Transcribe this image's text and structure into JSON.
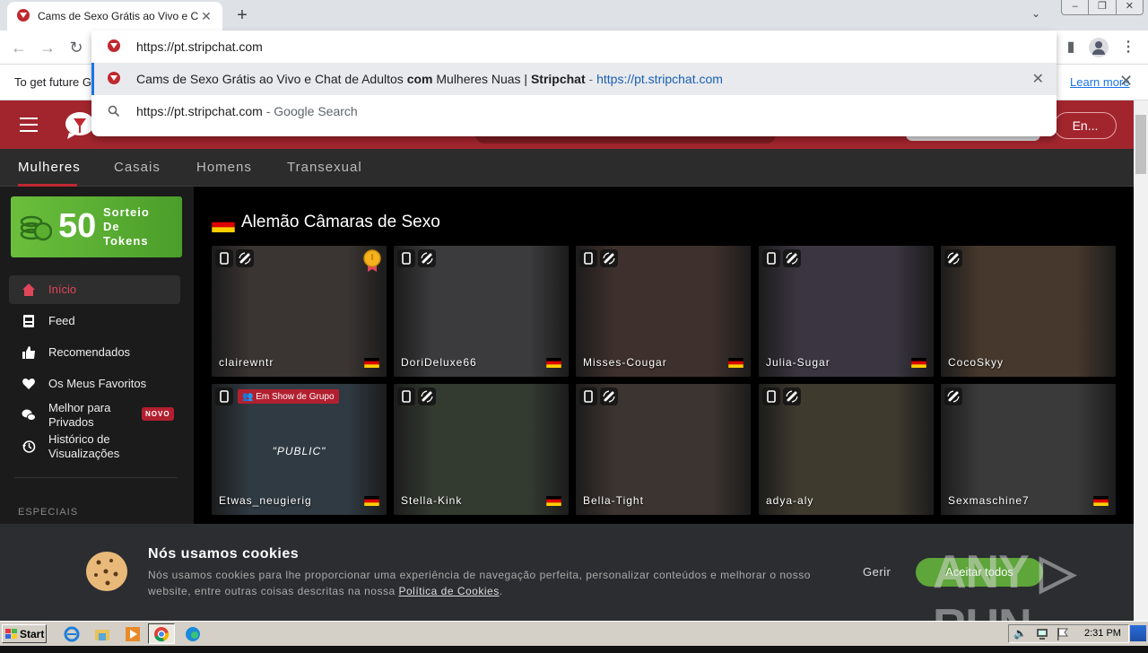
{
  "browser": {
    "tab_title": "Cams de Sexo Grátis ao Vivo e Chat de Adultos",
    "tab_close": "✕",
    "new_tab": "+",
    "tab_search": "⌄",
    "window_buttons": [
      "–",
      "❐",
      "✕"
    ],
    "omnibox_value": "https://pt.stripchat.com",
    "suggestions": [
      {
        "type": "history",
        "parts": [
          {
            "text": "Cams de Sexo Grátis ao Vivo e Chat de Adultos ",
            "style": "normal"
          },
          {
            "text": "com",
            "style": "bold"
          },
          {
            "text": " Mulheres Nuas | ",
            "style": "normal"
          },
          {
            "text": "Stripchat",
            "style": "bold"
          },
          {
            "text": " - ",
            "style": "grey"
          },
          {
            "text": "https://pt.stripchat.com",
            "style": "url"
          }
        ],
        "remove": "✕"
      },
      {
        "type": "search",
        "parts": [
          {
            "text": "https://pt.stripchat.com",
            "style": "normal"
          },
          {
            "text": " - Google Search",
            "style": "grey"
          }
        ]
      }
    ],
    "infobar_text": "To get future Google Chrome updates...",
    "infobar_link": "Learn more",
    "infobar_close": "✕"
  },
  "site": {
    "brand_color": "#a2252d",
    "lang_button": "En...",
    "category_tabs": [
      "Mulheres",
      "Casais",
      "Homens",
      "Transexual"
    ],
    "active_category": "Mulheres",
    "promo": {
      "amount": "50",
      "line1": "Sorteio",
      "line2": "De",
      "line3": "Tokens"
    },
    "sidebar": [
      {
        "label": "Início",
        "icon": "home-icon",
        "active": true
      },
      {
        "label": "Feed",
        "icon": "feed-icon"
      },
      {
        "label": "Recomendados",
        "icon": "thumbs-up-icon"
      },
      {
        "label": "Os Meus Favoritos",
        "icon": "heart-icon"
      },
      {
        "label": "Melhor para Privados",
        "icon": "chat-bubbles-icon",
        "badge": "NOVO"
      },
      {
        "label": "Histórico de Visualizações",
        "icon": "history-icon"
      }
    ],
    "sidebar_section": "ESPECIAIS",
    "section_title": "Alemão Câmaras de Sexo",
    "cards": [
      {
        "name": "clairewntr",
        "mobile": true,
        "toy": true,
        "medal": true
      },
      {
        "name": "DoriDeluxe66",
        "mobile": true,
        "toy": true
      },
      {
        "name": "Misses-Cougar",
        "mobile": true,
        "toy": true
      },
      {
        "name": "Julia-Sugar",
        "mobile": true,
        "toy": true
      },
      {
        "name": "CocoSkyy",
        "mobile": false,
        "toy": true,
        "no_flag": true
      },
      {
        "name": "Etwas_neugierig",
        "mobile": true,
        "toy": false,
        "group_show": "Em Show de Grupo",
        "overlay": "\"PUBLIC\""
      },
      {
        "name": "Stella-Kink",
        "mobile": true,
        "toy": true
      },
      {
        "name": "Bella-Tight",
        "mobile": true,
        "toy": true,
        "no_flag": true
      },
      {
        "name": "adya-aly",
        "mobile": true,
        "toy": true,
        "no_flag": true
      },
      {
        "name": "Sexmaschine7",
        "mobile": false,
        "toy": true
      }
    ],
    "cookie": {
      "title": "Nós usamos cookies",
      "desc": "Nós usamos cookies para lhe proporcionar uma experiência de navegação perfeita, personalizar conteúdos e melhorar o nosso website, entre outras coisas descritas na nossa ",
      "policy_link": "Política de Cookies",
      "desc_end": ".",
      "manage": "Gerir",
      "accept": "Aceitar todos"
    }
  },
  "watermark": "ANY ▷ RUN",
  "taskbar": {
    "start": "Start",
    "clock": "2:31 PM"
  }
}
